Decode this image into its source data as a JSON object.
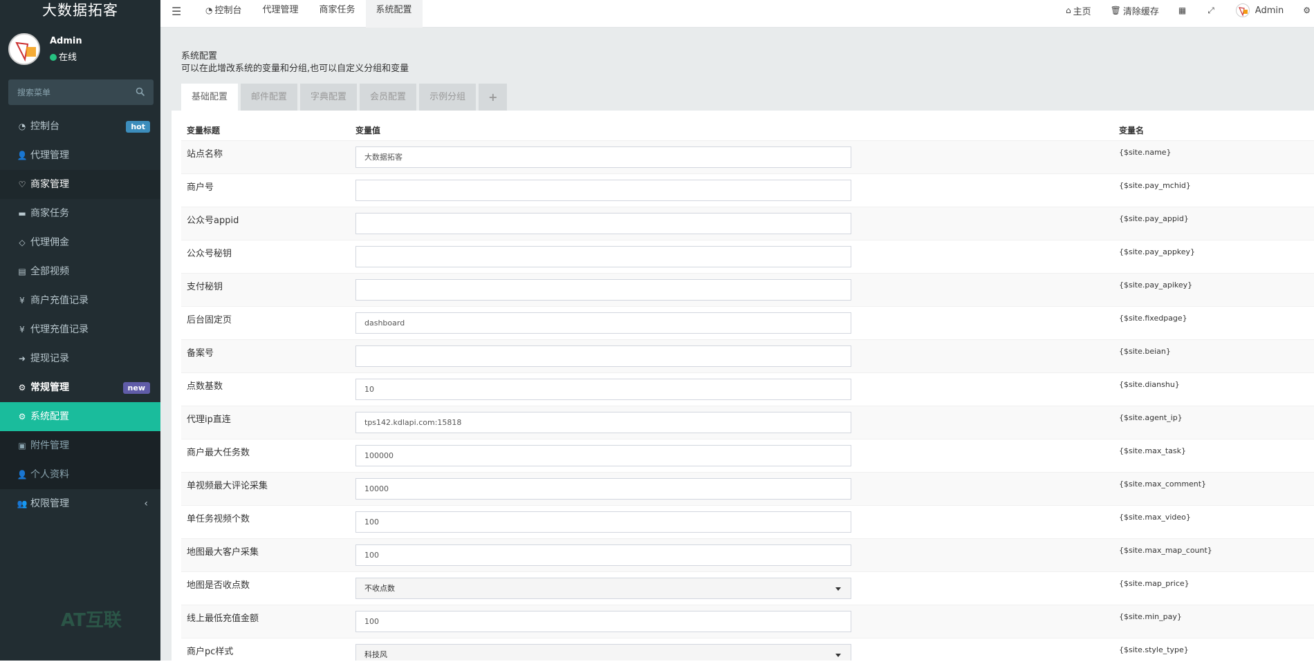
{
  "sidebar": {
    "logo": "大数据拓客",
    "user": {
      "name": "Admin",
      "status": "在线"
    },
    "search_placeholder": "搜索菜单",
    "menu": [
      {
        "label": "控制台",
        "icon": "dashboard-icon",
        "glyph": "◔",
        "badge": "hot",
        "state": "normal"
      },
      {
        "label": "代理管理",
        "icon": "user-plus-icon",
        "glyph": "👤",
        "state": "normal"
      },
      {
        "label": "商家管理",
        "icon": "handshake-icon",
        "glyph": "♡",
        "state": "open"
      },
      {
        "label": "商家任务",
        "icon": "keyboard-icon",
        "glyph": "▬",
        "state": "normal"
      },
      {
        "label": "代理佣金",
        "icon": "diamond-icon",
        "glyph": "◇",
        "state": "normal"
      },
      {
        "label": "全部视频",
        "icon": "file-icon",
        "glyph": "▤",
        "state": "normal"
      },
      {
        "label": "商户充值记录",
        "icon": "yen-icon",
        "glyph": "¥",
        "state": "normal"
      },
      {
        "label": "代理充值记录",
        "icon": "yen-icon",
        "glyph": "¥",
        "state": "normal"
      },
      {
        "label": "提现记录",
        "icon": "sign-in-icon",
        "glyph": "➜",
        "state": "normal"
      },
      {
        "label": "常规管理",
        "icon": "cogs-icon",
        "glyph": "⚙",
        "badge": "new",
        "state": "bold"
      },
      {
        "label": "系统配置",
        "icon": "cog-icon",
        "glyph": "⚙",
        "state": "active"
      },
      {
        "label": "附件管理",
        "icon": "file-image-icon",
        "glyph": "▣",
        "state": "sub"
      },
      {
        "label": "个人资料",
        "icon": "user-icon",
        "glyph": "👤",
        "state": "sub"
      },
      {
        "label": "权限管理",
        "icon": "group-icon",
        "glyph": "👥",
        "state": "normal",
        "chevron": "‹"
      }
    ],
    "watermark": "AT互联"
  },
  "topbar": {
    "tabs": [
      {
        "label": "控制台",
        "glyph": "◔",
        "active": false
      },
      {
        "label": "代理管理",
        "active": false
      },
      {
        "label": "商家任务",
        "active": false
      },
      {
        "label": "系统配置",
        "active": true
      }
    ],
    "right": {
      "home": "主页",
      "clear_cache": "清除缓存",
      "admin": "Admin"
    }
  },
  "panel": {
    "title": "系统配置",
    "description": "可以在此增改系统的变量和分组,也可以自定义分组和变量",
    "tabs": [
      "基础配置",
      "邮件配置",
      "字典配置",
      "会员配置",
      "示例分组"
    ],
    "add_tab": "+"
  },
  "table": {
    "headers": {
      "title": "变量标题",
      "value": "变量值",
      "name": "变量名"
    },
    "rows": [
      {
        "title": "站点名称",
        "value": "大数据拓客",
        "name": "{$site.name}",
        "kind": "input"
      },
      {
        "title": "商户号",
        "value": "",
        "name": "{$site.pay_mchid}",
        "kind": "input"
      },
      {
        "title": "公众号appid",
        "value": "",
        "name": "{$site.pay_appid}",
        "kind": "input"
      },
      {
        "title": "公众号秘钥",
        "value": "",
        "name": "{$site.pay_appkey}",
        "kind": "input"
      },
      {
        "title": "支付秘钥",
        "value": "",
        "name": "{$site.pay_apikey}",
        "kind": "input"
      },
      {
        "title": "后台固定页",
        "value": "dashboard",
        "name": "{$site.fixedpage}",
        "kind": "input"
      },
      {
        "title": "备案号",
        "value": "",
        "name": "{$site.beian}",
        "kind": "input"
      },
      {
        "title": "点数基数",
        "value": "10",
        "name": "{$site.dianshu}",
        "kind": "input"
      },
      {
        "title": "代理ip直连",
        "value": "tps142.kdlapi.com:15818",
        "name": "{$site.agent_ip}",
        "kind": "input"
      },
      {
        "title": "商户最大任务数",
        "value": "100000",
        "name": "{$site.max_task}",
        "kind": "input"
      },
      {
        "title": "单视频最大评论采集",
        "value": "10000",
        "name": "{$site.max_comment}",
        "kind": "input"
      },
      {
        "title": "单任务视频个数",
        "value": "100",
        "name": "{$site.max_video}",
        "kind": "input"
      },
      {
        "title": "地图最大客户采集",
        "value": "100",
        "name": "{$site.max_map_count}",
        "kind": "input"
      },
      {
        "title": "地图是否收点数",
        "value": "不收点数",
        "name": "{$site.map_price}",
        "kind": "select"
      },
      {
        "title": "线上最低充值金额",
        "value": "100",
        "name": "{$site.min_pay}",
        "kind": "input"
      },
      {
        "title": "商户pc样式",
        "value": "科技风",
        "name": "{$site.style_type}",
        "kind": "select"
      }
    ]
  }
}
